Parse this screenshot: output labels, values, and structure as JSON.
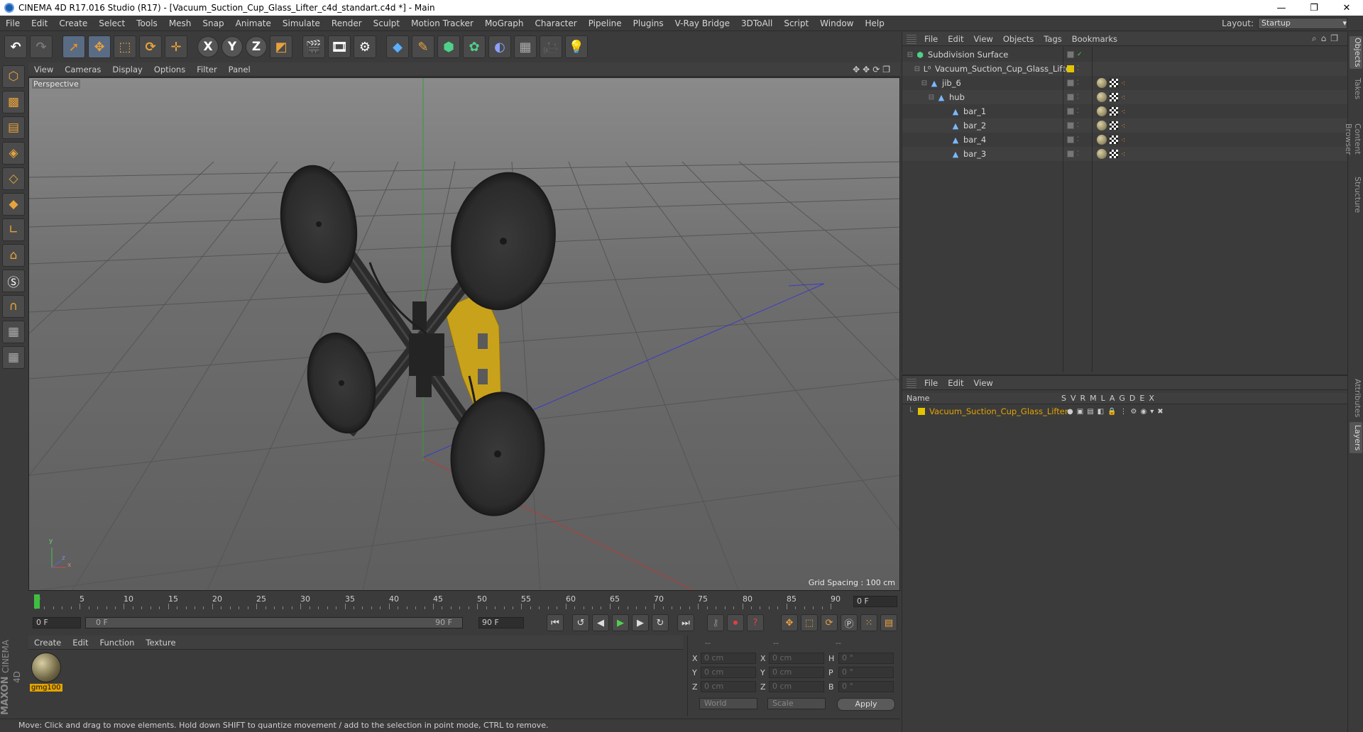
{
  "window": {
    "title": "CINEMA 4D R17.016 Studio (R17) - [Vacuum_Suction_Cup_Glass_Lifter_c4d_standart.c4d *] - Main",
    "controls": [
      "—",
      "❐",
      "✕"
    ]
  },
  "menubar": {
    "items": [
      "File",
      "Edit",
      "Create",
      "Select",
      "Tools",
      "Mesh",
      "Snap",
      "Animate",
      "Simulate",
      "Render",
      "Sculpt",
      "Motion Tracker",
      "MoGraph",
      "Character",
      "Pipeline",
      "Plugins",
      "V-Ray Bridge",
      "3DToAll",
      "Script",
      "Window",
      "Help"
    ],
    "layout_label": "Layout:",
    "layout_value": "Startup"
  },
  "toolbar": {
    "buttons": [
      "undo-icon",
      "redo-icon",
      "select-arrow-icon",
      "move-icon",
      "scale-icon",
      "rotate-icon",
      "live-select-icon",
      "x-axis",
      "y-axis",
      "z-axis",
      "coord-system-icon",
      "render-view-icon",
      "render-picture-icon",
      "render-settings-icon",
      "cube-icon",
      "pen-icon",
      "subdivision-icon",
      "cloner-icon",
      "deformer-icon",
      "floor-icon",
      "camera-icon",
      "light-icon"
    ],
    "x": "X",
    "y": "Y",
    "z": "Z"
  },
  "viewport": {
    "menu": [
      "View",
      "Cameras",
      "Display",
      "Options",
      "Filter",
      "Panel"
    ],
    "nav_icons": "✥✥⟳❐",
    "label": "Perspective",
    "grid_spacing": "Grid Spacing : 100 cm",
    "axis_x": "x",
    "axis_y": "y",
    "axis_z": "z"
  },
  "timeline": {
    "frames": [
      "0",
      "5",
      "10",
      "15",
      "20",
      "25",
      "30",
      "35",
      "40",
      "45",
      "50",
      "55",
      "60",
      "65",
      "70",
      "75",
      "80",
      "85",
      "90"
    ],
    "current_frame": "0 F"
  },
  "transport": {
    "start_field": "0 F",
    "range_start": "0 F",
    "range_end": "90 F",
    "end_field": "90 F"
  },
  "material_manager": {
    "menu": [
      "Create",
      "Edit",
      "Function",
      "Texture"
    ],
    "material_name": "gmg100"
  },
  "branding": {
    "maxon": "MAXON",
    "product": "CINEMA 4D"
  },
  "coordinates": {
    "headers": [
      "--",
      "--",
      "--"
    ],
    "rows": [
      {
        "a_label": "X",
        "a_val": "0 cm",
        "b_label": "X",
        "b_val": "0 cm",
        "c_label": "H",
        "c_val": "0 °"
      },
      {
        "a_label": "Y",
        "a_val": "0 cm",
        "b_label": "Y",
        "b_val": "0 cm",
        "c_label": "P",
        "c_val": "0 °"
      },
      {
        "a_label": "Z",
        "a_val": "0 cm",
        "b_label": "Z",
        "b_val": "0 cm",
        "c_label": "B",
        "c_val": "0 °"
      }
    ],
    "mode_world": "World",
    "mode_scale": "Scale",
    "apply": "Apply"
  },
  "statusbar": {
    "text": "Move: Click and drag to move elements. Hold down SHIFT to quantize movement / add to the selection in point mode, CTRL to remove."
  },
  "object_manager": {
    "menu": [
      "File",
      "Edit",
      "View",
      "Objects",
      "Tags",
      "Bookmarks"
    ],
    "objects": [
      {
        "name": "Subdivision Surface",
        "tree": "⊟",
        "icon": "subdivision-icon"
      },
      {
        "name": "Vacuum_Suction_Cup_Glass_Lifter",
        "tree": "⊟",
        "icon": "null-icon"
      },
      {
        "name": "jib_6",
        "tree": "⊟",
        "icon": "polygon-icon"
      },
      {
        "name": "hub",
        "tree": "⊟",
        "icon": "polygon-icon"
      },
      {
        "name": "bar_1",
        "tree": "",
        "icon": "polygon-icon"
      },
      {
        "name": "bar_2",
        "tree": "",
        "icon": "polygon-icon"
      },
      {
        "name": "bar_4",
        "tree": "",
        "icon": "polygon-icon"
      },
      {
        "name": "bar_3",
        "tree": "",
        "icon": "polygon-icon"
      }
    ]
  },
  "layer_manager": {
    "menu": [
      "File",
      "Edit",
      "View"
    ],
    "col_name": "Name",
    "col_flags": [
      "S",
      "V",
      "R",
      "M",
      "L",
      "A",
      "G",
      "D",
      "E",
      "X"
    ],
    "layer_name": "Vacuum_Suction_Cup_Glass_Lifter",
    "layer_color": "#e3c400"
  },
  "side_tabs": [
    "Objects",
    "Takes",
    "Content Browser",
    "Structure",
    "Attributes",
    "Layers"
  ],
  "colors": {
    "accent": "#e3a400",
    "viewport_bg": "#6d6d6d",
    "panel_bg": "#3b3b3b"
  }
}
